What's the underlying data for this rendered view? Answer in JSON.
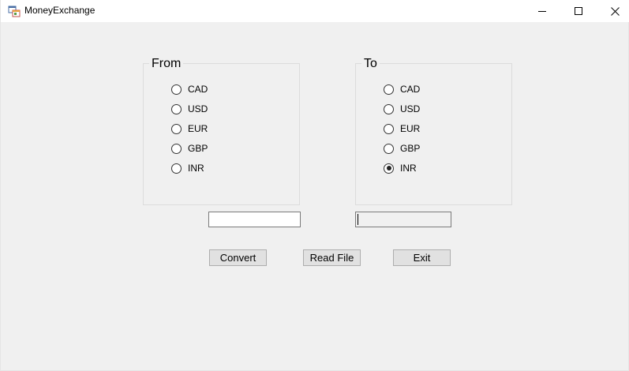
{
  "window": {
    "title": "MoneyExchange",
    "app_icon": "app-window-icon",
    "controls": [
      "minimize-icon",
      "maximize-icon",
      "close-icon"
    ]
  },
  "from_group": {
    "title": "From",
    "options": [
      {
        "label": "CAD",
        "checked": false
      },
      {
        "label": "USD",
        "checked": false
      },
      {
        "label": "EUR",
        "checked": false
      },
      {
        "label": "GBP",
        "checked": false
      },
      {
        "label": "INR",
        "checked": false
      }
    ]
  },
  "to_group": {
    "title": "To",
    "options": [
      {
        "label": "CAD",
        "checked": false
      },
      {
        "label": "USD",
        "checked": false
      },
      {
        "label": "EUR",
        "checked": false
      },
      {
        "label": "GBP",
        "checked": false
      },
      {
        "label": "INR",
        "checked": true
      }
    ]
  },
  "amount_input": {
    "value": ""
  },
  "result_output": {
    "value": ""
  },
  "buttons": {
    "convert": "Convert",
    "read_file": "Read File",
    "exit": "Exit"
  }
}
